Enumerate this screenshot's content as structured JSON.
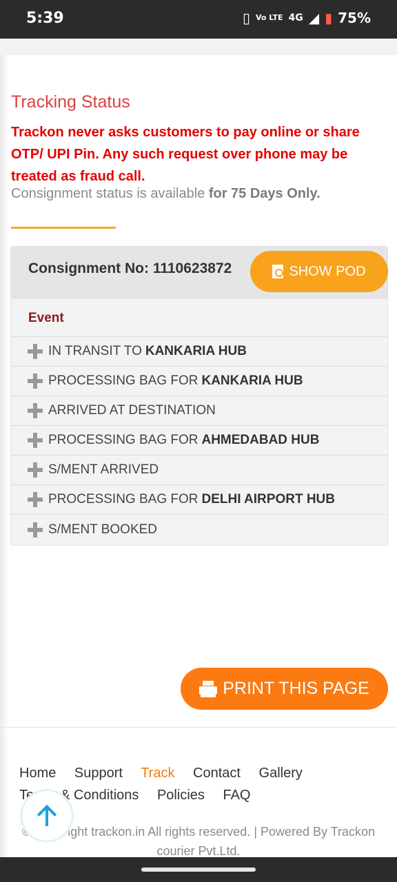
{
  "status_bar": {
    "time": "5:39",
    "volte": "Vo LTE",
    "network": "4G",
    "battery": "75%"
  },
  "page": {
    "title": "Tracking Status",
    "warning": "Trackon never asks customers to pay online or share OTP/ UPI Pin. Any such request over phone may be treated as fraud call.",
    "availability_prefix": "Consignment status is available",
    "availability_bold": "for 75 Days Only."
  },
  "consignment": {
    "label": "Consignment No: 1110623872",
    "show_pod_label": "SHOW POD",
    "event_header": "Event",
    "events": [
      {
        "text": "IN TRANSIT TO",
        "bold": "KANKARIA HUB"
      },
      {
        "text": "PROCESSING BAG FOR",
        "bold": "KANKARIA HUB"
      },
      {
        "text": "ARRIVED AT DESTINATION",
        "bold": ""
      },
      {
        "text": "PROCESSING BAG FOR",
        "bold": "AHMEDABAD HUB"
      },
      {
        "text": "S/MENT ARRIVED",
        "bold": ""
      },
      {
        "text": "PROCESSING BAG FOR",
        "bold": "DELHI AIRPORT HUB"
      },
      {
        "text": "S/MENT BOOKED",
        "bold": ""
      }
    ]
  },
  "print_label": "PRINT THIS PAGE",
  "footer": {
    "links": [
      "Home",
      "Support",
      "Track",
      "Contact",
      "Gallery",
      "Terms & Conditions",
      "Policies",
      "FAQ"
    ],
    "active": "Track",
    "copyright": "© Copyright trackon.in All rights reserved.   |   Powered By Trackon courier Pvt.Ltd."
  },
  "colors": {
    "accent": "#f9a21c",
    "print_button": "#fb7a12",
    "warning": "#e50000",
    "title": "#d84141"
  }
}
